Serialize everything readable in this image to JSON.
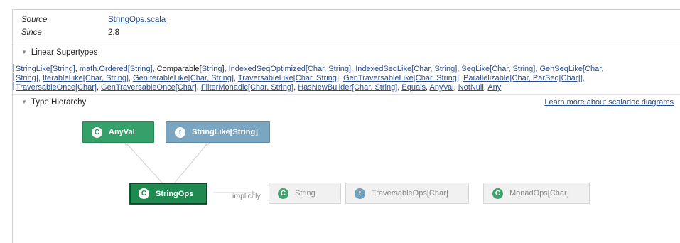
{
  "source": {
    "key": "Source",
    "value": "StringOps.scala"
  },
  "since": {
    "key": "Since",
    "value": "2.8"
  },
  "linear": {
    "title": "Linear Supertypes",
    "line1": [
      {
        "t": "StringLike[String]",
        "l": true
      },
      {
        "t": ", ",
        "l": false
      },
      {
        "t": "math.Ordered[String]",
        "l": true
      },
      {
        "t": ", Comparable[",
        "l": false
      },
      {
        "t": "String",
        "l": true
      },
      {
        "t": "], ",
        "l": false
      },
      {
        "t": "IndexedSeqOptimized[Char, String]",
        "l": true
      },
      {
        "t": ", ",
        "l": false
      },
      {
        "t": "IndexedSeqLike[Char, String]",
        "l": true
      },
      {
        "t": ", ",
        "l": false
      },
      {
        "t": "SeqLike[Char, String]",
        "l": true
      },
      {
        "t": ", ",
        "l": false
      },
      {
        "t": "GenSeqLike[Char,",
        "l": true
      }
    ],
    "line2": [
      {
        "t": "String]",
        "l": true
      },
      {
        "t": ", ",
        "l": false
      },
      {
        "t": "IterableLike[Char, String]",
        "l": true
      },
      {
        "t": ", ",
        "l": false
      },
      {
        "t": "GenIterableLike[Char, String]",
        "l": true
      },
      {
        "t": ", ",
        "l": false
      },
      {
        "t": "TraversableLike[Char, String]",
        "l": true
      },
      {
        "t": ", ",
        "l": false
      },
      {
        "t": "GenTraversableLike[Char, String]",
        "l": true
      },
      {
        "t": ", ",
        "l": false
      },
      {
        "t": "Parallelizable[Char, ParSeq[Char]]",
        "l": true
      },
      {
        "t": ",",
        "l": false
      }
    ],
    "line3": [
      {
        "t": "TraversableOnce[Char]",
        "l": true
      },
      {
        "t": ", ",
        "l": false
      },
      {
        "t": "GenTraversableOnce[Char]",
        "l": true
      },
      {
        "t": ", ",
        "l": false
      },
      {
        "t": "FilterMonadic[Char, String]",
        "l": true
      },
      {
        "t": ", ",
        "l": false
      },
      {
        "t": "HasNewBuilder[Char, String]",
        "l": true
      },
      {
        "t": ", ",
        "l": false
      },
      {
        "t": "Equals",
        "l": true
      },
      {
        "t": ", ",
        "l": false
      },
      {
        "t": "AnyVal",
        "l": true
      },
      {
        "t": ", ",
        "l": false
      },
      {
        "t": "NotNull",
        "l": true
      },
      {
        "t": ", ",
        "l": false
      },
      {
        "t": "Any",
        "l": true
      }
    ]
  },
  "hierarchy": {
    "title": "Type Hierarchy",
    "learn_more": "Learn more about scaladoc diagrams",
    "implicitly": "implicitly",
    "nodes": {
      "anyval": {
        "icon": "C",
        "label": "AnyVal"
      },
      "stringlike": {
        "icon": "t",
        "label": "StringLike[String]"
      },
      "stringops": {
        "icon": "C",
        "label": "StringOps"
      },
      "string": {
        "icon": "C",
        "label": "String"
      },
      "traversableops": {
        "icon": "t",
        "label": "TraversableOps[Char]"
      },
      "monadops": {
        "icon": "C",
        "label": "MonadOps[Char]"
      }
    }
  },
  "colors": {
    "link": "#2a4d8a",
    "class_node": "#35a06a",
    "trait_node": "#7aa6c2",
    "current_node": "#1e8a4f",
    "implicit_node": "#f1f1f1"
  }
}
